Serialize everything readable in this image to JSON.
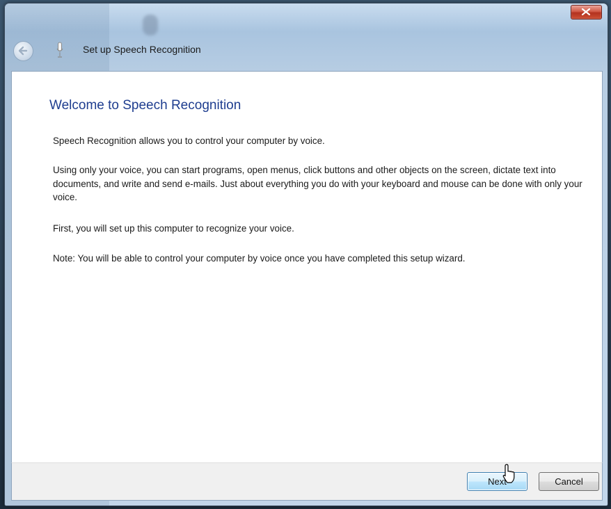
{
  "window": {
    "title": "Set up Speech Recognition",
    "close_icon": "close-icon",
    "back_icon": "back-arrow-icon",
    "app_icon": "microphone-icon"
  },
  "main": {
    "heading": "Welcome to Speech Recognition",
    "paragraphs": [
      "Speech Recognition allows you to control your computer by voice.",
      "Using only your voice, you can start programs, open menus, click buttons and other objects on the screen, dictate text into documents, and write and send e-mails. Just about everything you do with your keyboard and mouse can be done with only your voice.",
      "First, you will set up this computer to recognize your voice.",
      "Note: You will be able to control your computer by voice once you have completed this setup wizard."
    ]
  },
  "footer": {
    "next_label": "Next",
    "cancel_label": "Cancel"
  },
  "colors": {
    "heading": "#1e3d8f",
    "close_button": "#c9432e",
    "next_button_border": "#3c7fb1"
  }
}
